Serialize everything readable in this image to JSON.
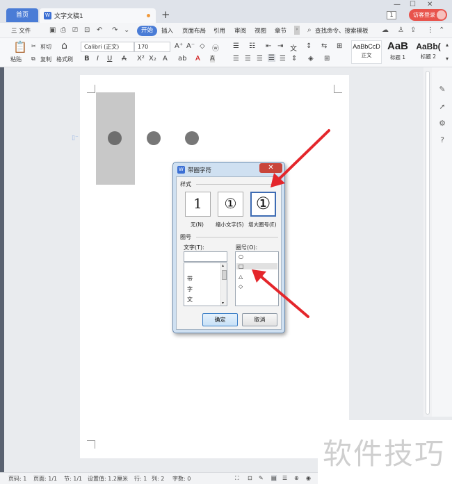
{
  "tabs": {
    "home": "首页",
    "doc": "文字文稿1",
    "plus": "+"
  },
  "window": {
    "num": "1",
    "login": "访客登录"
  },
  "menu": {
    "file": "三 文件",
    "items": [
      "开始",
      "插入",
      "页面布局",
      "引用",
      "审阅",
      "视图",
      "章节"
    ],
    "search": "查找命令、搜索模板"
  },
  "ribbon": {
    "paste": "粘贴",
    "cut": "剪切",
    "copy": "复制",
    "format_painter": "格式刷",
    "font_name": "Calibri (正文)",
    "font_size": "170",
    "styles": [
      {
        "sample": "AaBbCcD",
        "name": "正文"
      },
      {
        "sample": "AaB",
        "name": "标题 1"
      },
      {
        "sample": "AaBb(",
        "name": "标题 2"
      }
    ]
  },
  "dialog": {
    "title": "带圈字符",
    "style_group": "样式",
    "options": [
      {
        "glyph": "1",
        "label": "无(N)"
      },
      {
        "glyph": "①",
        "label": "缩小文字(S)"
      },
      {
        "glyph": "①",
        "label": "增大圈号(E)"
      }
    ],
    "circle_group": "圈号",
    "text_label": "文字(T):",
    "text_value": "",
    "text_list": [
      "带",
      "字",
      "文"
    ],
    "circle_label": "圈号(O):",
    "circle_list": [
      "○",
      "□",
      "△",
      "◇"
    ],
    "ok": "确定",
    "cancel": "取消"
  },
  "status": {
    "page": "页码: 1",
    "pages": "页面: 1/1",
    "section": "节: 1/1",
    "setting": "设置值: 1.2厘米",
    "row": "行: 1",
    "col": "列: 2",
    "words": "字数: 0"
  },
  "watermark": "软件技巧",
  "colors": {
    "accent": "#4a7cd6",
    "arrow": "#e4262b",
    "login": "#e8534c",
    "circle": "#777777"
  }
}
